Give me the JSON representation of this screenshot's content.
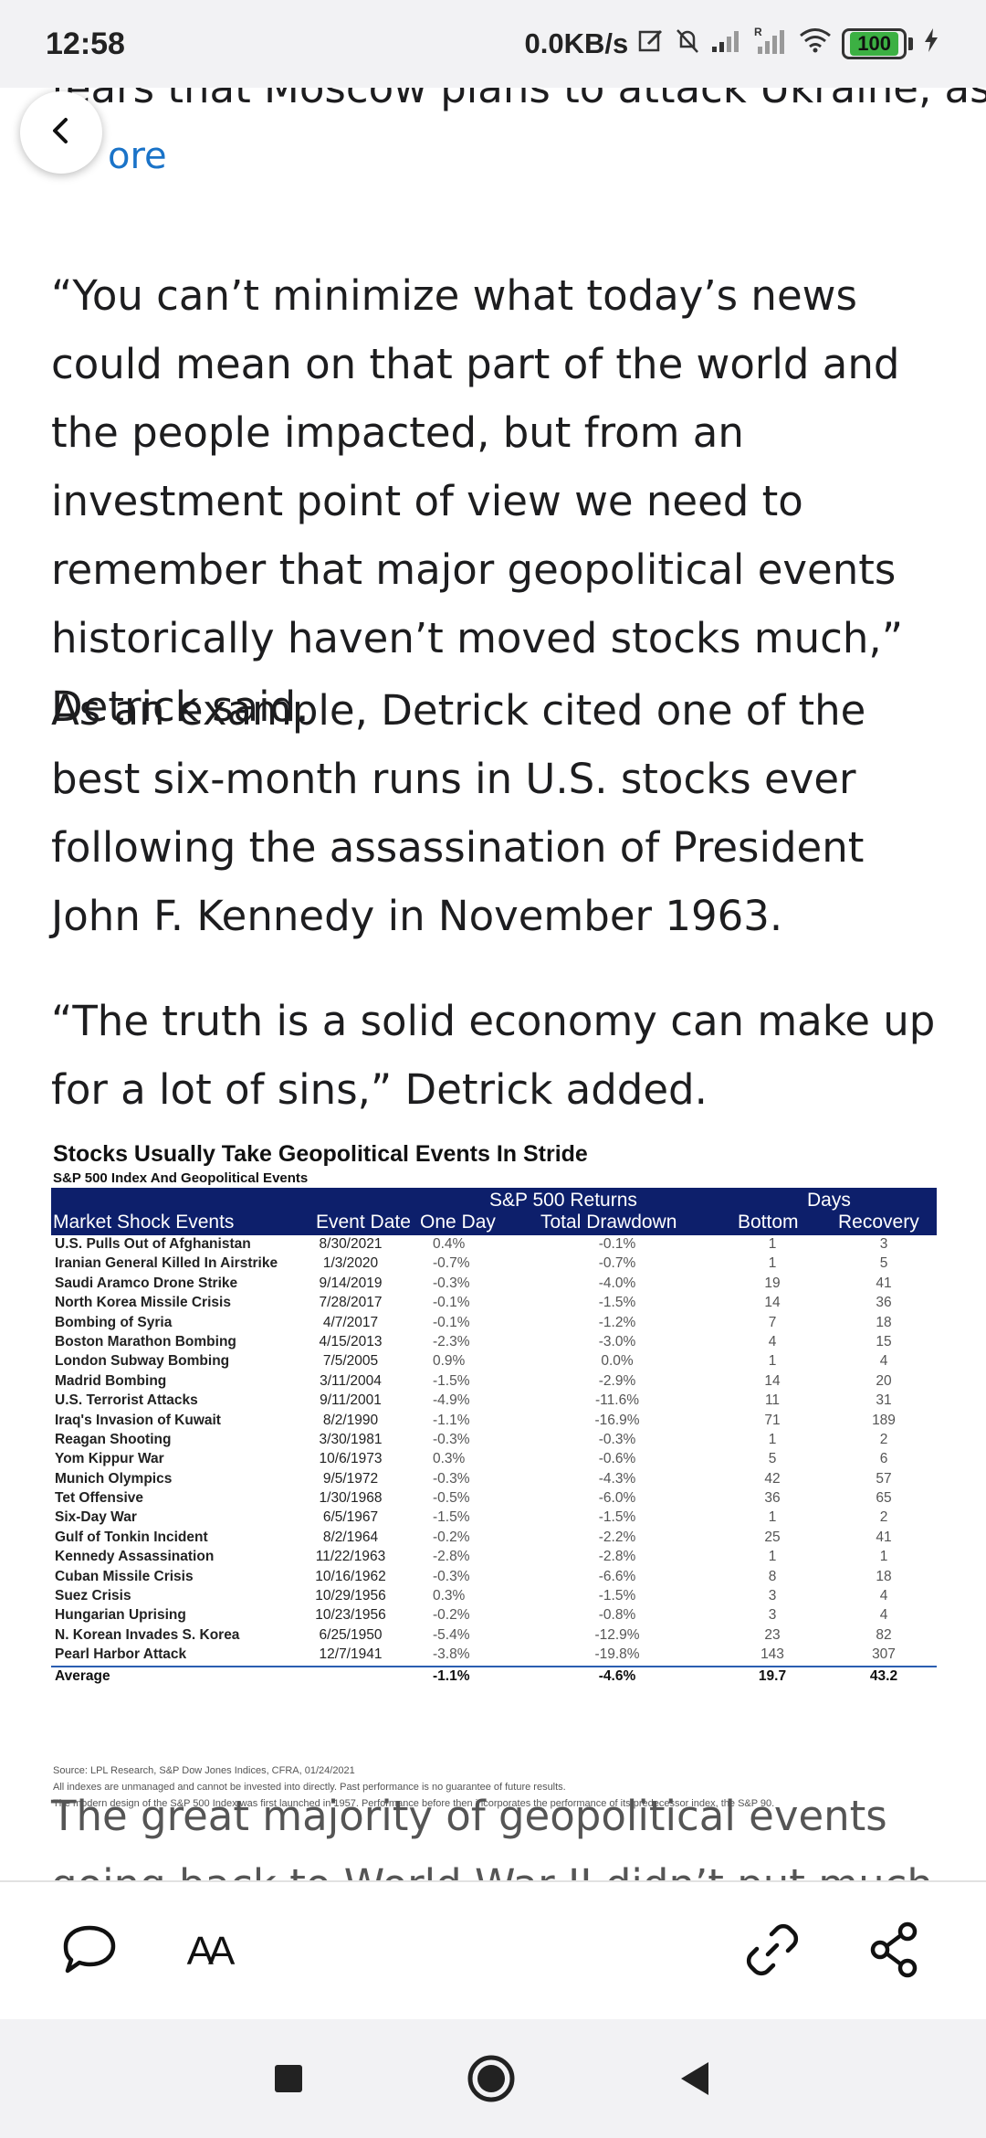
{
  "status_bar": {
    "time": "12:58",
    "network_speed": "0.0KB/s",
    "battery_level": "100",
    "icons": [
      "edit-icon",
      "mute-bell-icon",
      "signal-icon",
      "roaming-signal-icon",
      "wifi-icon",
      "battery-icon",
      "charging-icon"
    ]
  },
  "article": {
    "cut_line": "fears that Moscow plans to attack Ukraine, as",
    "more_link": "ore",
    "paragraphs": [
      "“You can’t minimize what today’s news could mean on that part of the world and the people impacted, but from an investment point of view we need to remember that major geopolitical events historically haven’t moved stocks much,” Detrick said.",
      "As an example, Detrick cited one of the best six-month runs in U.S. stocks ever following the assassination of President John F. Kennedy in November 1963.",
      "“The truth is a solid economy can make up for a lot of sins,” Detrick added.",
      "The great majority of geopolitical events going back to World War II didn’t put much of a dent in stocks"
    ]
  },
  "figure": {
    "title": "Stocks Usually Take Geopolitical Events In Stride",
    "subtitle": "S&P 500 Index And Geopolitical Events",
    "group_returns": "S&P 500 Returns",
    "group_days": "Days",
    "columns": [
      "Market Shock Events",
      "Event Date",
      "One Day",
      "Total Drawdown",
      "Bottom",
      "Recovery"
    ],
    "rows": [
      [
        "U.S. Pulls Out of Afghanistan",
        "8/30/2021",
        "0.4%",
        "-0.1%",
        "1",
        "3"
      ],
      [
        "Iranian General Killed In Airstrike",
        "1/3/2020",
        "-0.7%",
        "-0.7%",
        "1",
        "5"
      ],
      [
        "Saudi Aramco Drone Strike",
        "9/14/2019",
        "-0.3%",
        "-4.0%",
        "19",
        "41"
      ],
      [
        "North Korea Missile Crisis",
        "7/28/2017",
        "-0.1%",
        "-1.5%",
        "14",
        "36"
      ],
      [
        "Bombing of Syria",
        "4/7/2017",
        "-0.1%",
        "-1.2%",
        "7",
        "18"
      ],
      [
        "Boston Marathon Bombing",
        "4/15/2013",
        "-2.3%",
        "-3.0%",
        "4",
        "15"
      ],
      [
        "London Subway Bombing",
        "7/5/2005",
        "0.9%",
        "0.0%",
        "1",
        "4"
      ],
      [
        "Madrid Bombing",
        "3/11/2004",
        "-1.5%",
        "-2.9%",
        "14",
        "20"
      ],
      [
        "U.S. Terrorist Attacks",
        "9/11/2001",
        "-4.9%",
        "-11.6%",
        "11",
        "31"
      ],
      [
        "Iraq's Invasion of Kuwait",
        "8/2/1990",
        "-1.1%",
        "-16.9%",
        "71",
        "189"
      ],
      [
        "Reagan Shooting",
        "3/30/1981",
        "-0.3%",
        "-0.3%",
        "1",
        "2"
      ],
      [
        "Yom Kippur War",
        "10/6/1973",
        "0.3%",
        "-0.6%",
        "5",
        "6"
      ],
      [
        "Munich Olympics",
        "9/5/1972",
        "-0.3%",
        "-4.3%",
        "42",
        "57"
      ],
      [
        "Tet Offensive",
        "1/30/1968",
        "-0.5%",
        "-6.0%",
        "36",
        "65"
      ],
      [
        "Six-Day War",
        "6/5/1967",
        "-1.5%",
        "-1.5%",
        "1",
        "2"
      ],
      [
        "Gulf of Tonkin Incident",
        "8/2/1964",
        "-0.2%",
        "-2.2%",
        "25",
        "41"
      ],
      [
        "Kennedy Assassination",
        "11/22/1963",
        "-2.8%",
        "-2.8%",
        "1",
        "1"
      ],
      [
        "Cuban Missile Crisis",
        "10/16/1962",
        "-0.3%",
        "-6.6%",
        "8",
        "18"
      ],
      [
        "Suez Crisis",
        "10/29/1956",
        "0.3%",
        "-1.5%",
        "3",
        "4"
      ],
      [
        "Hungarian Uprising",
        "10/23/1956",
        "-0.2%",
        "-0.8%",
        "3",
        "4"
      ],
      [
        "N. Korean Invades S. Korea",
        "6/25/1950",
        "-5.4%",
        "-12.9%",
        "23",
        "82"
      ],
      [
        "Pearl Harbor Attack",
        "12/7/1941",
        "-3.8%",
        "-19.8%",
        "143",
        "307"
      ]
    ],
    "average": [
      "Average",
      "",
      "-1.1%",
      "-4.6%",
      "19.7",
      "43.2"
    ],
    "source_lines": [
      "Source: LPL Research, S&P Dow Jones Indices, CFRA, 01/24/2021",
      "All indexes are unmanaged and cannot be invested into directly.  Past performance is no guarantee of future results.",
      "The modern design of the S&P 500 Index was first launched in 1957. Performance before then incorporates the performance of its predecessor index, the S&P 90."
    ]
  },
  "toolbar": {
    "font_size_label": "AA",
    "icons": [
      "comment-icon",
      "font-size-icon",
      "link-icon",
      "share-icon"
    ]
  },
  "navbar": {
    "icons": [
      "recents-square-icon",
      "home-circle-icon",
      "back-triangle-icon"
    ]
  },
  "colors": {
    "link": "#1a73c8",
    "table_header": "#0d1f6b",
    "battery": "#3cb043"
  }
}
